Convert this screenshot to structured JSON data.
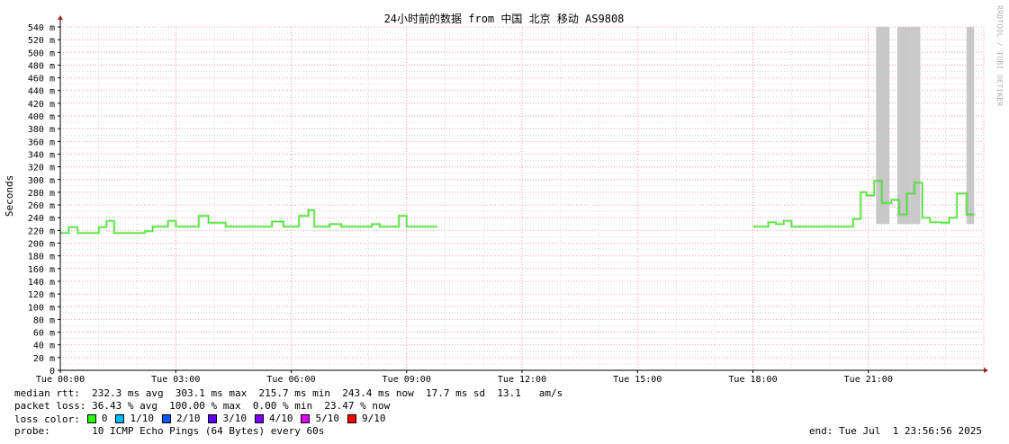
{
  "chart_data": {
    "type": "line",
    "title": "24小时前的数据 from 中国 北京 移动 AS9808",
    "ylabel": "Seconds",
    "ylim": [
      0,
      540
    ],
    "y_ticks": [
      "0",
      "20 m",
      "40 m",
      "60 m",
      "80 m",
      "100 m",
      "120 m",
      "140 m",
      "160 m",
      "180 m",
      "200 m",
      "220 m",
      "240 m",
      "260 m",
      "280 m",
      "300 m",
      "320 m",
      "340 m",
      "360 m",
      "380 m",
      "400 m",
      "420 m",
      "440 m",
      "460 m",
      "480 m",
      "500 m",
      "520 m",
      "540 m"
    ],
    "x_ticks": [
      "Tue 00:00",
      "Tue 03:00",
      "Tue 06:00",
      "Tue 09:00",
      "Tue 12:00",
      "Tue 15:00",
      "Tue 18:00",
      "Tue 21:00"
    ],
    "x_unit": "hours",
    "xlim": [
      0,
      24
    ],
    "grid": true,
    "series": [
      {
        "name": "median rtt",
        "segments": [
          [
            [
              0.0,
              216
            ],
            [
              0.22,
              216
            ],
            [
              0.22,
              225
            ],
            [
              0.45,
              225
            ],
            [
              0.45,
              216
            ],
            [
              1.0,
              216
            ],
            [
              1.0,
              225
            ],
            [
              1.2,
              225
            ],
            [
              1.2,
              235
            ],
            [
              1.4,
              235
            ],
            [
              1.4,
              216
            ],
            [
              2.2,
              216
            ],
            [
              2.2,
              219
            ],
            [
              2.4,
              219
            ],
            [
              2.4,
              226
            ],
            [
              2.8,
              226
            ],
            [
              2.8,
              235
            ],
            [
              3.0,
              235
            ],
            [
              3.0,
              226
            ],
            [
              3.6,
              226
            ],
            [
              3.6,
              243
            ],
            [
              3.85,
              243
            ],
            [
              3.85,
              232
            ],
            [
              4.3,
              232
            ],
            [
              4.3,
              226
            ],
            [
              5.5,
              226
            ],
            [
              5.5,
              234
            ],
            [
              5.8,
              234
            ],
            [
              5.8,
              226
            ],
            [
              6.2,
              226
            ],
            [
              6.2,
              243
            ],
            [
              6.45,
              243
            ],
            [
              6.45,
              252
            ],
            [
              6.6,
              252
            ],
            [
              6.6,
              226
            ],
            [
              7.0,
              226
            ],
            [
              7.0,
              230
            ],
            [
              7.3,
              230
            ],
            [
              7.3,
              226
            ],
            [
              8.1,
              226
            ],
            [
              8.1,
              230
            ],
            [
              8.3,
              230
            ],
            [
              8.3,
              226
            ],
            [
              8.8,
              226
            ],
            [
              8.8,
              243
            ],
            [
              9.0,
              243
            ],
            [
              9.0,
              226
            ],
            [
              9.8,
              226
            ]
          ],
          [
            [
              18.0,
              226
            ],
            [
              18.4,
              226
            ],
            [
              18.4,
              233
            ],
            [
              18.6,
              233
            ],
            [
              18.6,
              230
            ],
            [
              18.8,
              230
            ],
            [
              18.8,
              235
            ],
            [
              19.0,
              235
            ],
            [
              19.0,
              226
            ],
            [
              20.6,
              226
            ],
            [
              20.6,
              238
            ],
            [
              20.8,
              238
            ],
            [
              20.8,
              280
            ],
            [
              20.95,
              280
            ],
            [
              20.95,
              275
            ],
            [
              21.15,
              275
            ],
            [
              21.15,
              298
            ],
            [
              21.35,
              298
            ],
            [
              21.35,
              263
            ],
            [
              21.6,
              263
            ],
            [
              21.6,
              268
            ],
            [
              21.8,
              268
            ],
            [
              21.8,
              245
            ],
            [
              22.0,
              245
            ],
            [
              22.0,
              278
            ],
            [
              22.2,
              278
            ],
            [
              22.2,
              295
            ],
            [
              22.4,
              295
            ],
            [
              22.4,
              240
            ],
            [
              22.6,
              240
            ],
            [
              22.6,
              233
            ],
            [
              22.9,
              233
            ],
            [
              22.9,
              232
            ],
            [
              23.1,
              232
            ],
            [
              23.1,
              240
            ],
            [
              23.3,
              240
            ],
            [
              23.3,
              278
            ],
            [
              23.55,
              278
            ],
            [
              23.55,
              245
            ],
            [
              23.75,
              245
            ]
          ]
        ]
      }
    ],
    "loss_spikes_hours": [
      [
        21.2,
        21.55
      ],
      [
        21.75,
        22.1
      ],
      [
        22.1,
        22.35
      ],
      [
        23.55,
        23.75
      ]
    ]
  },
  "stats": {
    "median_rtt": "median rtt:  232.3 ms avg  303.1 ms max  215.7 ms min  243.4 ms now  17.7 ms sd  13.1   am/s",
    "packet_loss": "packet loss: 36.43 % avg  100.00 % max  0.00 % min  23.47 % now",
    "loss_color_label": "loss color:",
    "probe": "probe:       10 ICMP Echo Pings (64 Bytes) every 60s",
    "end": "end: Tue Jul  1 23:56:56 2025"
  },
  "legend": [
    {
      "label": "0",
      "color": "#26ff00"
    },
    {
      "label": "1/10",
      "color": "#00b8ff"
    },
    {
      "label": "2/10",
      "color": "#0059ff"
    },
    {
      "label": "3/10",
      "color": "#5e00ff"
    },
    {
      "label": "4/10",
      "color": "#7e00ff"
    },
    {
      "label": "5/10",
      "color": "#dd00ff"
    },
    {
      "label": "9/10",
      "color": "#ff0000"
    }
  ],
  "watermark": "RRDTOOL / TOBI OETIKER",
  "colors": {
    "grid_major": "#f0a0a0",
    "grid_minor": "#dcdcdc",
    "axis": "#000000",
    "arrow": "#a02020",
    "smoke_light": "#c8c8c8",
    "smoke_dark": "#505050"
  }
}
